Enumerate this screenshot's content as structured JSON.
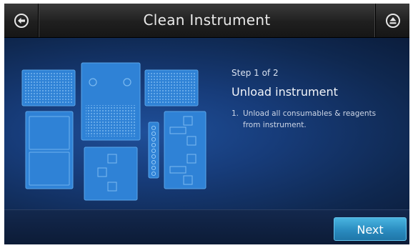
{
  "header": {
    "title": "Clean Instrument",
    "back_icon": "back-arrow-icon",
    "eject_icon": "eject-icon"
  },
  "content": {
    "step": "Step 1 of 2",
    "heading": "Unload instrument",
    "instruction_number": "1.",
    "instruction_line1": "Unload all consumables & reagents",
    "instruction_line2": "from instrument."
  },
  "footer": {
    "next_label": "Next"
  },
  "colors": {
    "accent": "#2a8cc0",
    "consumable": "#2f82d6",
    "header": "#2a2a2a"
  }
}
